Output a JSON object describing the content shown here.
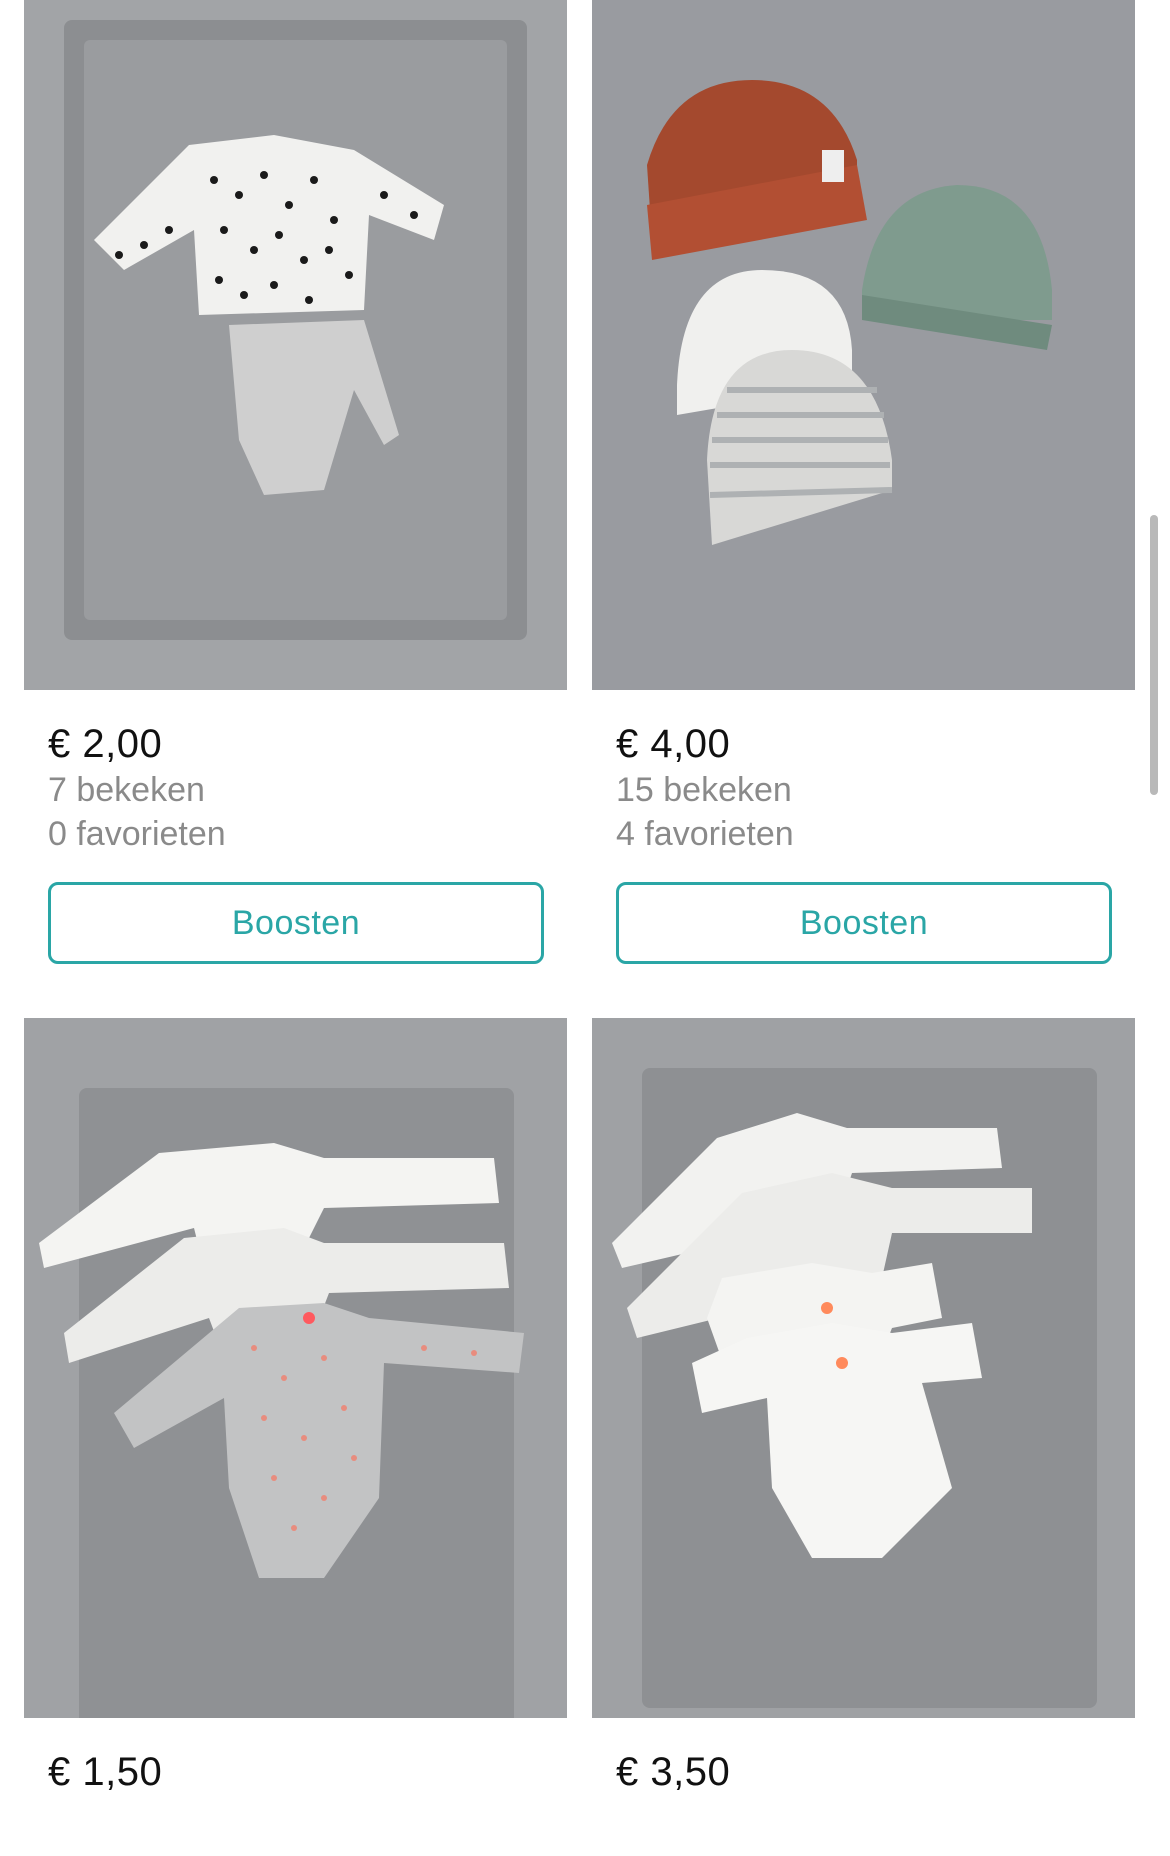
{
  "listings": [
    {
      "price": "€ 2,00",
      "views": "7 bekeken",
      "favorites": "0 favorieten",
      "boost_label": "Boosten",
      "photo_subject": "dotted-shirt-and-grey-pants"
    },
    {
      "price": "€ 4,00",
      "views": "15 bekeken",
      "favorites": "4 favorieten",
      "boost_label": "Boosten",
      "photo_subject": "four-baby-hats"
    },
    {
      "price": "€ 1,50",
      "photo_subject": "three-longsleeve-bodysuits"
    },
    {
      "price": "€ 3,50",
      "photo_subject": "four-white-wrap-bodysuits"
    }
  ],
  "colors": {
    "accent": "#2aa6a6",
    "muted_text": "#8a8a8a",
    "price_text": "#111111"
  }
}
